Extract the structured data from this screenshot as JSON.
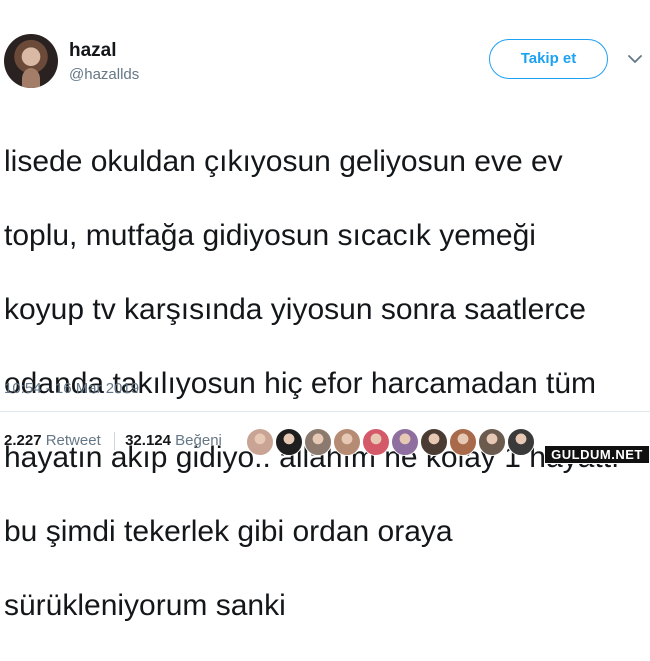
{
  "user": {
    "display_name": "hazal",
    "handle": "@hazallds"
  },
  "follow_button": {
    "label": "Takip et"
  },
  "tweet": {
    "text_lines": [
      "lisede okuldan çıkıyosun geliyosun eve ev",
      "toplu, mutfağa gidiyosun sıcacık yemeği",
      "koyup tv karşısında yiyosun sonra saatlerce",
      "odanda takılıyosun hiç efor harcamadan tüm",
      "hayatın akıp gidiyo.. allahım ne kolay 1 hayattı",
      "bu şimdi tekerlek gibi ordan oraya",
      "sürükleniyorum sanki"
    ],
    "timestamp": "10:54 - 16 Mar 2019"
  },
  "stats": {
    "retweet_count": "2.227",
    "retweet_label": "Retweet",
    "like_count": "32.124",
    "like_label": "Beğeni"
  },
  "likers": [
    {
      "name": "liker-1",
      "color": "#c9a394"
    },
    {
      "name": "liker-2",
      "color": "#1e1e1e"
    },
    {
      "name": "liker-3",
      "color": "#8c7a6e"
    },
    {
      "name": "liker-4",
      "color": "#b58c73"
    },
    {
      "name": "liker-5",
      "color": "#d45a6a"
    },
    {
      "name": "liker-6",
      "color": "#8e6f9f"
    },
    {
      "name": "liker-7",
      "color": "#4a3b33"
    },
    {
      "name": "liker-8",
      "color": "#a86a4a"
    },
    {
      "name": "liker-9",
      "color": "#6b5a4e"
    },
    {
      "name": "liker-10",
      "color": "#3a3a3a"
    }
  ],
  "watermark": {
    "text": "GULDUM.NET"
  },
  "colors": {
    "accent": "#1da1f2",
    "text": "#14171a",
    "secondary": "#657786"
  }
}
